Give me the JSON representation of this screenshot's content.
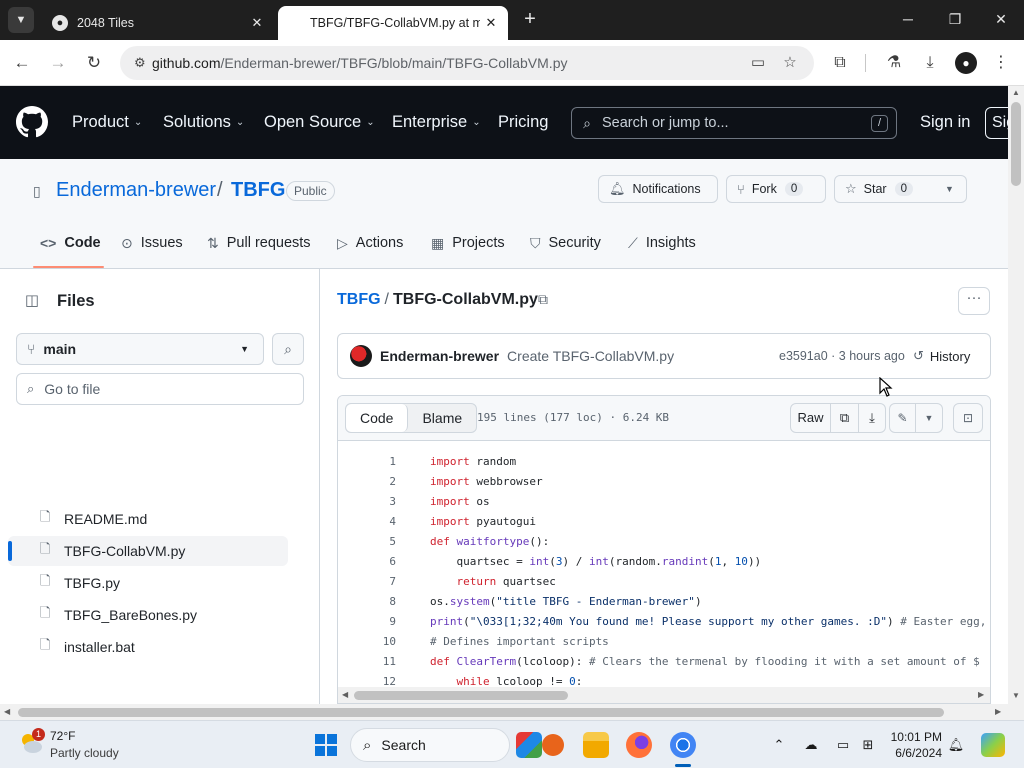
{
  "browser": {
    "tabs": [
      {
        "title": "2048 Tiles",
        "active": false
      },
      {
        "title": "TBFG/TBFG-CollabVM.py at main",
        "active": true
      }
    ],
    "url_host": "github.com",
    "url_path": "/Enderman-brewer/TBFG/blob/main/TBFG-CollabVM.py"
  },
  "gh_header": {
    "nav": [
      "Product",
      "Solutions",
      "Open Source",
      "Enterprise",
      "Pricing"
    ],
    "search_placeholder": "Search or jump to...",
    "search_shortcut": "/",
    "sign_in": "Sign in",
    "sign_up": "Sign up"
  },
  "repo": {
    "owner": "Enderman-brewer",
    "separator": "/",
    "name": "TBFG",
    "visibility": "Public",
    "notifications_label": "Notifications",
    "fork_label": "Fork",
    "fork_count": "0",
    "star_label": "Star",
    "star_count": "0",
    "tabs": [
      "Code",
      "Issues",
      "Pull requests",
      "Actions",
      "Projects",
      "Security",
      "Insights"
    ]
  },
  "sidebar": {
    "title": "Files",
    "branch": "main",
    "goto_placeholder": "Go to file",
    "files": [
      "README.md",
      "TBFG-CollabVM.py",
      "TBFG.py",
      "TBFG_BareBones.py",
      "installer.bat"
    ],
    "selected_index": 1
  },
  "file": {
    "crumb_repo": "TBFG",
    "crumb_sep": "/",
    "crumb_file": "TBFG-CollabVM.py",
    "commit_author": "Enderman-brewer",
    "commit_message": "Create TBFG-CollabVM.py",
    "commit_meta": "e3591a0 · 3 hours ago",
    "history_label": "History",
    "view_code": "Code",
    "view_blame": "Blame",
    "stats": "195 lines (177 loc) · 6.24 KB",
    "raw_label": "Raw"
  },
  "code_lines": [
    {
      "n": "1",
      "t": "import random"
    },
    {
      "n": "2",
      "t": "import webbrowser"
    },
    {
      "n": "3",
      "t": "import os"
    },
    {
      "n": "4",
      "t": "import pyautogui"
    },
    {
      "n": "5",
      "t": "def waitfortype():"
    },
    {
      "n": "6",
      "t": "    quartsec = int(3) / int(random.randint(1, 10))"
    },
    {
      "n": "7",
      "t": "    return quartsec"
    },
    {
      "n": "8",
      "t": "os.system(\"title TBFG - Enderman-brewer\")"
    },
    {
      "n": "9",
      "t": "print(\"\\033[1;32;40m You found me! Please support my other games. :D\") # Easter egg,"
    },
    {
      "n": "10",
      "t": "# Defines important scripts"
    },
    {
      "n": "11",
      "t": "def ClearTerm(lcoloop): # Clears the termenal by flooding it with a set amount of $"
    },
    {
      "n": "12",
      "t": "    while lcoloop != 0:"
    }
  ],
  "taskbar": {
    "weather_temp": "72°F",
    "weather_desc": "Partly cloudy",
    "weather_badge": "1",
    "search_label": "Search",
    "time": "10:01 PM",
    "date": "6/6/2024"
  },
  "colors": {
    "gh_header_bg": "#0d1117",
    "link_blue": "#0969da",
    "tab_underline": "#fd8c73"
  }
}
